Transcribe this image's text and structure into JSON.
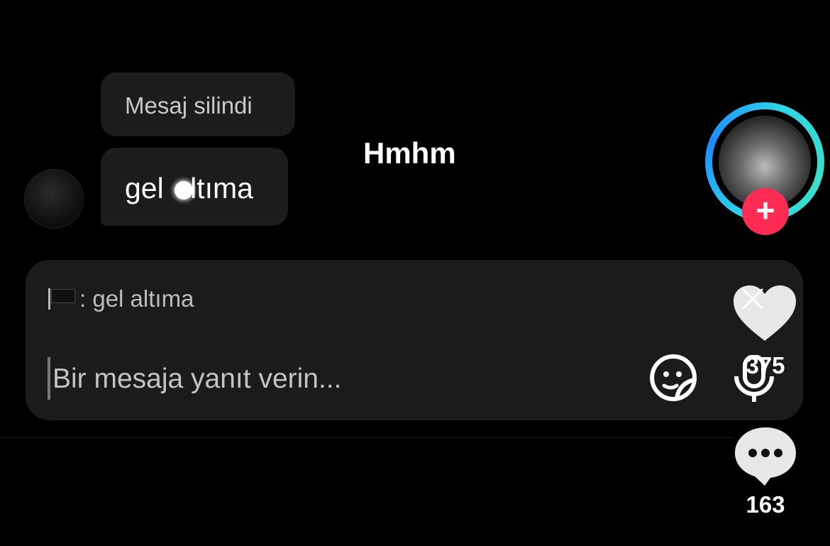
{
  "chat": {
    "deleted_message": "Mesaj silindi",
    "message_before": "gel ",
    "message_after": "ltıma"
  },
  "overlay_caption": "Hmhm",
  "reply": {
    "quote_text": ": gel altıma",
    "placeholder": "Bir mesaja yanıt verin..."
  },
  "actions": {
    "like_count": "375",
    "comment_count": "163",
    "follow_symbol": "+"
  },
  "icons": {
    "flag": "flag-icon",
    "sticker": "sticker-icon",
    "mic": "mic-icon",
    "close": "close-icon",
    "like": "heart-icon",
    "comment": "comment-icon"
  },
  "colors": {
    "background": "#000000",
    "bubble": "#1c1c1c",
    "follow": "#fe2c55",
    "ring_primary": "#2fd6e6",
    "ring_secondary": "#1e8bff"
  }
}
